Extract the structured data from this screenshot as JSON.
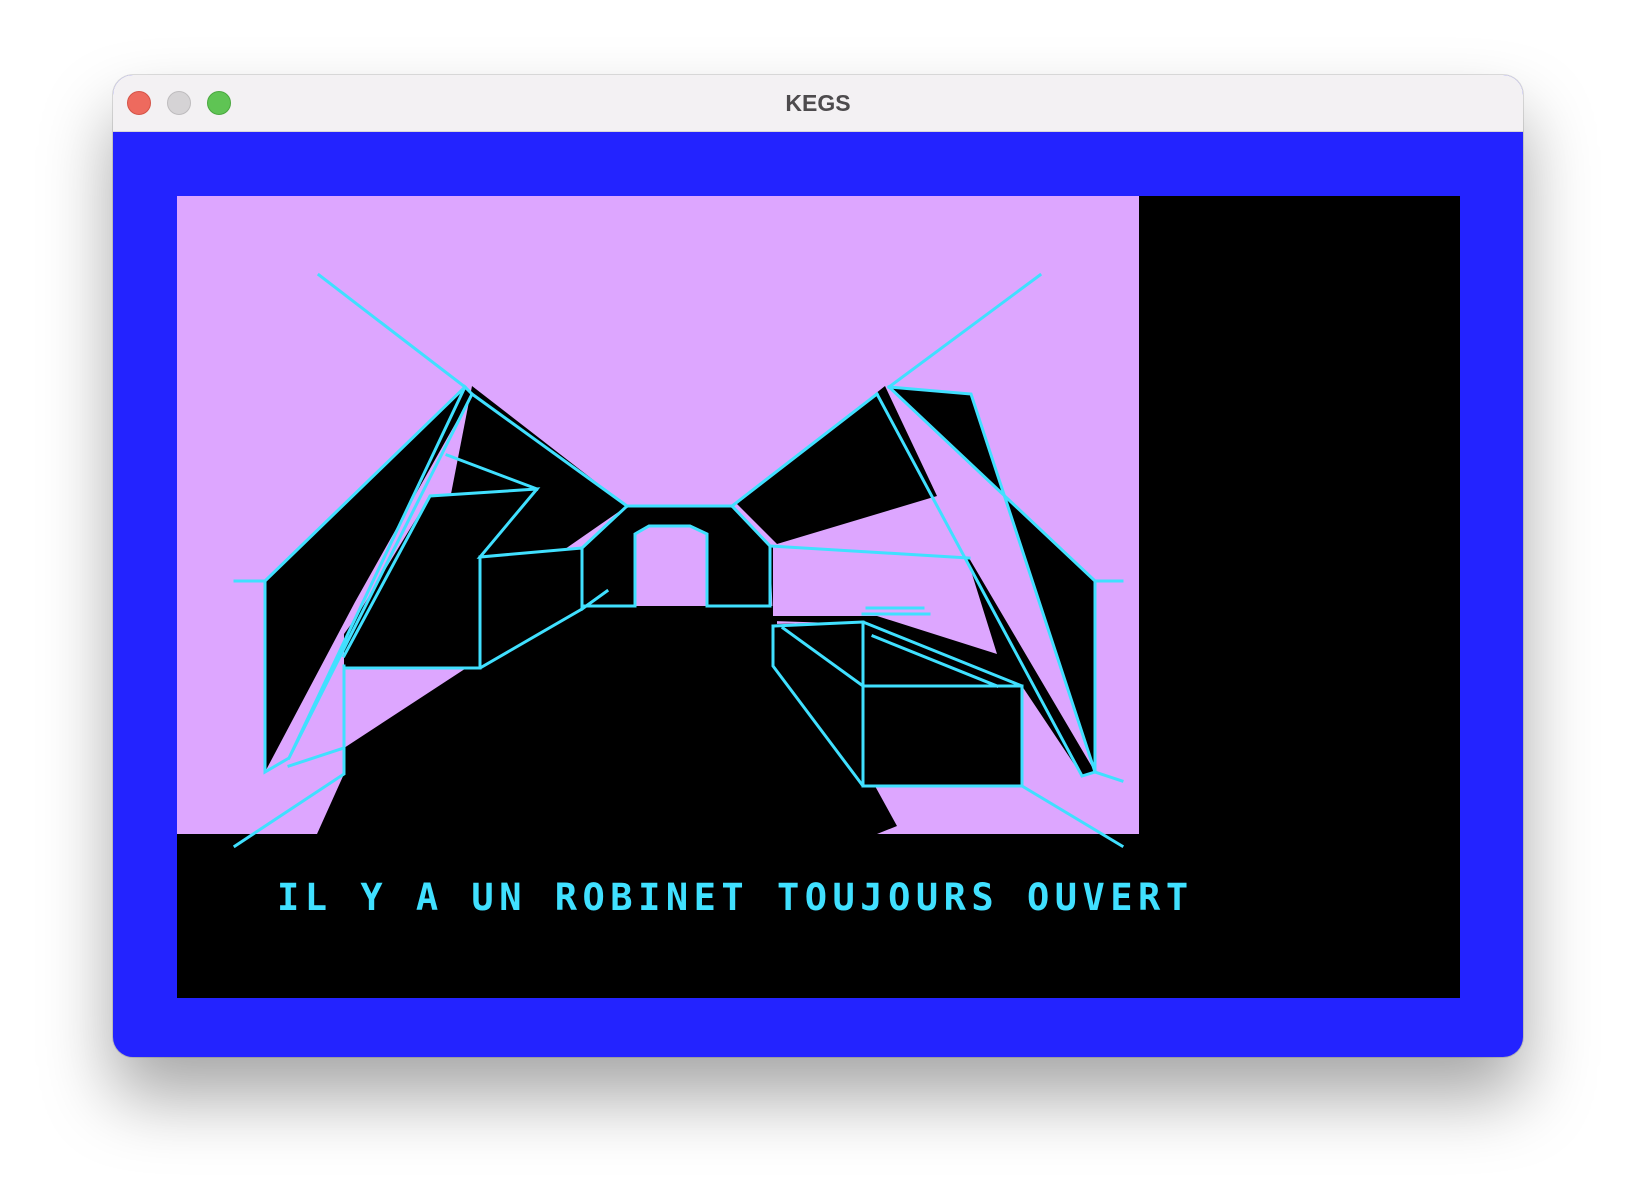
{
  "window": {
    "title": "KEGS",
    "controls": [
      "close",
      "minimize",
      "zoom"
    ]
  },
  "screen": {
    "border_color": "#2323ff",
    "wall_color": "#dda6ff",
    "line_color": "#40e0ff",
    "background_color": "#000000",
    "message": "IL Y A UN ROBINET TOUJOURS OUVERT"
  }
}
